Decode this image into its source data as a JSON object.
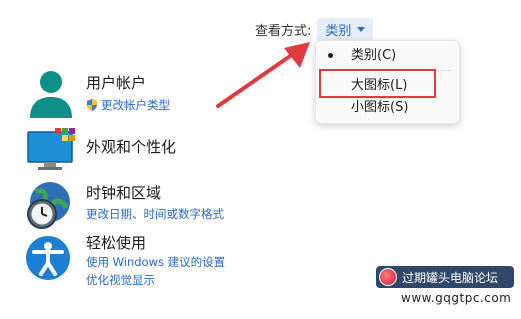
{
  "header": {
    "viewby_label": "查看方式:",
    "viewby_value": "类别"
  },
  "dropdown": {
    "items": [
      {
        "label": "类别(C)",
        "selected": true
      },
      {
        "label": "大图标(L)",
        "selected": false,
        "highlighted": true
      },
      {
        "label": "小图标(S)",
        "selected": false
      }
    ]
  },
  "categories": [
    {
      "title": "用户帐户",
      "icon": "user-accounts-icon",
      "links": [
        "更改帐户类型"
      ],
      "link_icon": "uac-shield-icon"
    },
    {
      "title": "外观和个性化",
      "icon": "appearance-personalization-icon",
      "links": []
    },
    {
      "title": "时钟和区域",
      "icon": "clock-region-icon",
      "links": [
        "更改日期、时间或数字格式"
      ]
    },
    {
      "title": "轻松使用",
      "icon": "ease-of-access-icon",
      "links": [
        "使用 Windows 建议的设置",
        "优化视觉显示"
      ]
    }
  ],
  "watermark": {
    "name": "过期罐头电脑论坛",
    "url": "www.gqgtpc.com"
  },
  "colors": {
    "link": "#2a6cc4",
    "annotation_red": "#e0393e",
    "menu_bg": "#fafafa"
  }
}
